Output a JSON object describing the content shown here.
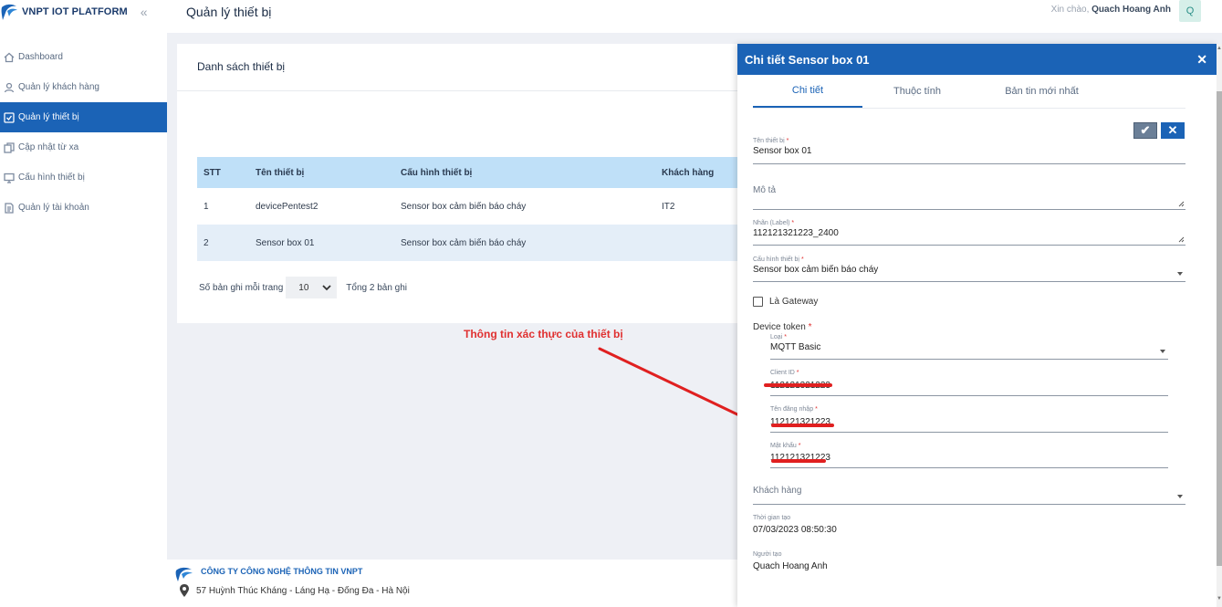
{
  "brand": {
    "name": "VNPT IOT PLATFORM"
  },
  "sidebar": {
    "items": [
      {
        "label": "Dashboard"
      },
      {
        "label": "Quản lý khách hàng"
      },
      {
        "label": "Quản lý thiết bị"
      },
      {
        "label": "Cập nhật từ xa"
      },
      {
        "label": "Cấu hình thiết bị"
      },
      {
        "label": "Quản lý tài khoản"
      }
    ]
  },
  "header": {
    "title": "Quản lý thiết bị",
    "greeting": "Xin chào,",
    "user": "Quach Hoang Anh",
    "avatar": "Q"
  },
  "list": {
    "title": "Danh sách thiết bị",
    "columns": [
      "STT",
      "Tên thiết bị",
      "Cấu hình thiết bị",
      "Khách hàng"
    ],
    "rows": [
      {
        "stt": "1",
        "name": "devicePentest2",
        "config": "Sensor box cảm biến báo cháy",
        "customer": "IT2"
      },
      {
        "stt": "2",
        "name": "Sensor box 01",
        "config": "Sensor box cảm biến báo cháy",
        "customer": ""
      }
    ],
    "per_page_label": "Số bản ghi mỗi trang",
    "per_page_value": "10",
    "total": "Tổng 2 bản ghi"
  },
  "annotation": "Thông tin xác thực của thiết bị",
  "footer": {
    "company": "CÔNG TY CÔNG NGHỆ THÔNG TIN VNPT",
    "address": "57 Huỳnh Thúc Kháng - Láng Hạ - Đống Đa - Hà Nội"
  },
  "panel": {
    "title": "Chi tiết Sensor box 01",
    "tabs": [
      "Chi tiết",
      "Thuộc tính",
      "Bản tin mới nhất"
    ],
    "fields": {
      "name_label": "Tên thiết bị",
      "name_value": "Sensor box 01",
      "desc_label": "Mô tả",
      "nhan_label": "Nhãn (Label)",
      "nhan_value": "112121321223_2400",
      "config_label": "Cấu hình thiết bị",
      "config_value": "Sensor box cảm biến báo cháy",
      "gateway_label": "Là Gateway",
      "token_label": "Device token",
      "type_label": "Loại",
      "type_value": "MQTT Basic",
      "client_label": "Client ID",
      "client_value": "112121321223",
      "user_label": "Tên đăng nhập",
      "user_value": "112121321223",
      "pass_label": "Mật khẩu",
      "pass_value": "112121321223",
      "customer_label": "Khách hàng",
      "created_label": "Thời gian tạo",
      "created_value": "07/03/2023 08:50:30",
      "creator_label": "Người tạo",
      "creator_value": "Quach Hoang Anh",
      "required_mark": "*"
    }
  },
  "colors": {
    "primary": "#1b63b6",
    "table_header": "#bfe0f8",
    "annotation": "#e03030"
  }
}
